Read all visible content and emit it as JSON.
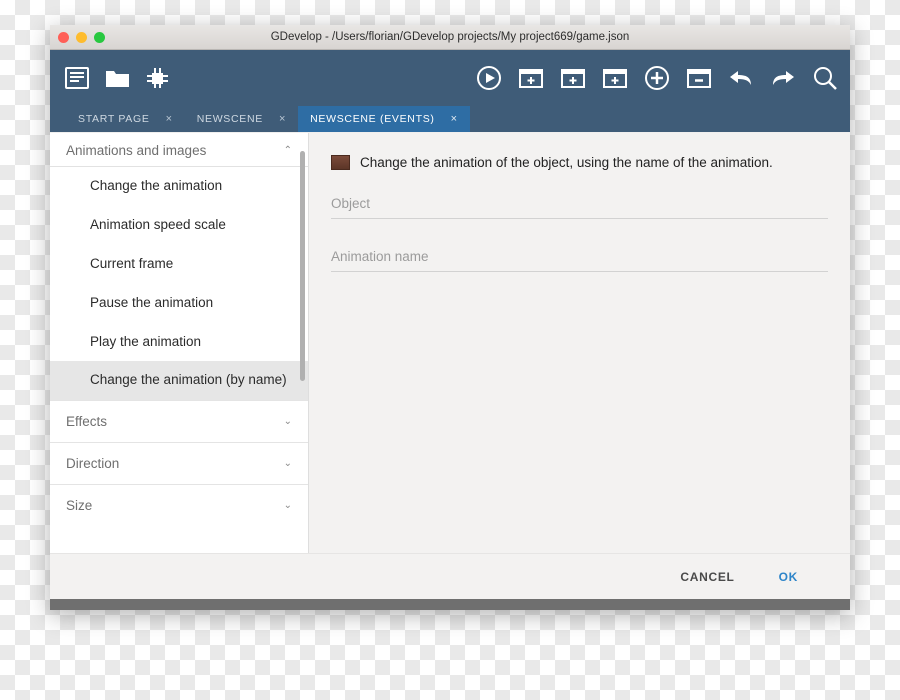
{
  "window": {
    "title": "GDevelop - /Users/florian/GDevelop projects/My project669/game.json",
    "traffic_lights": [
      "close",
      "minimize",
      "zoom"
    ]
  },
  "toolbar": {
    "left_icons": [
      {
        "name": "open-project-icon",
        "glyph": "book"
      },
      {
        "name": "folder-icon",
        "glyph": "folder"
      },
      {
        "name": "scene-editor-icon",
        "glyph": "chip"
      }
    ],
    "right_icons": [
      {
        "name": "preview-play-icon",
        "glyph": "play"
      },
      {
        "name": "add-scene-icon",
        "glyph": "add-window"
      },
      {
        "name": "add-external-layout-icon",
        "glyph": "add-window-2"
      },
      {
        "name": "add-external-events-icon",
        "glyph": "add-window-3"
      },
      {
        "name": "add-object-icon",
        "glyph": "plus-circle"
      },
      {
        "name": "open-debugger-icon",
        "glyph": "window-minus"
      },
      {
        "name": "undo-icon",
        "glyph": "undo-arrow"
      },
      {
        "name": "redo-icon",
        "glyph": "redo-arrow"
      },
      {
        "name": "search-icon",
        "glyph": "magnifier"
      }
    ]
  },
  "tabs": [
    {
      "label": "START PAGE",
      "close": "×",
      "active": false
    },
    {
      "label": "NEWSCENE",
      "close": "×",
      "active": false
    },
    {
      "label": "NEWSCENE (EVENTS)",
      "close": "×",
      "active": true
    }
  ],
  "dialog": {
    "category_header": {
      "label": "Animations and images",
      "chevron": "⌃"
    },
    "actions": [
      {
        "label": "Change the animation",
        "selected": false
      },
      {
        "label": "Animation speed scale",
        "selected": false
      },
      {
        "label": "Current frame",
        "selected": false
      },
      {
        "label": "Pause the animation",
        "selected": false
      },
      {
        "label": "Play the animation",
        "selected": false
      },
      {
        "label": "Change the animation (by name)",
        "selected": true
      }
    ],
    "collapsed_sections": [
      {
        "label": "Effects",
        "chevron": "⌄"
      },
      {
        "label": "Direction",
        "chevron": "⌄"
      },
      {
        "label": "Size",
        "chevron": "⌄"
      }
    ],
    "description": "Change the animation of the object, using the name of the animation.",
    "fields": [
      {
        "name": "object",
        "value": "",
        "placeholder": "Object"
      },
      {
        "name": "animation-name",
        "value": "",
        "placeholder": "Animation name"
      }
    ],
    "buttons": {
      "cancel": "CANCEL",
      "ok": "OK"
    }
  },
  "colors": {
    "toolbar": "#3f5c78",
    "active_tab": "#2e6da4",
    "ok_button": "#2e85c9",
    "selected_row": "#e6e6e6"
  }
}
